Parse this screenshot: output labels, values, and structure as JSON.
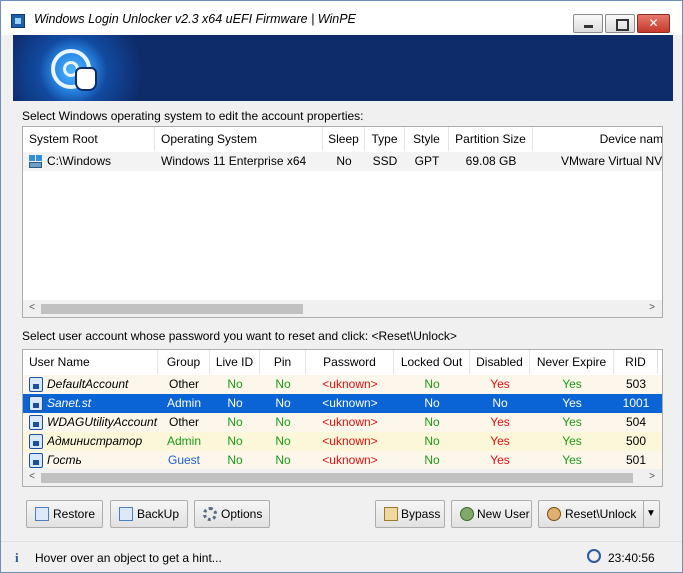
{
  "window": {
    "title": "Windows Login Unlocker v2.3 x64   uEFI Firmware | WinPE",
    "min_symbol": "",
    "max_symbol": "",
    "close_symbol": "✕"
  },
  "os_section": {
    "label": "Select Windows operating system to edit the account properties:",
    "columns": [
      "System Root",
      "Operating System",
      "Sleep",
      "Type",
      "Style",
      "Partition Size",
      "Device nam"
    ],
    "rows": [
      [
        "C:\\Windows",
        "Windows 11 Enterprise x64",
        "No",
        "SSD",
        "GPT",
        "69.08 GB",
        "VMware Virtual NV"
      ]
    ],
    "scroll_left": "<",
    "scroll_right": ">"
  },
  "user_section": {
    "label": "Select user account whose password you want to reset and click: <Reset\\Unlock>",
    "columns": [
      "User Name",
      "Group",
      "Live ID",
      "Pin",
      "Password",
      "Locked Out",
      "Disabled",
      "Never Expire",
      "RID"
    ],
    "rows": [
      [
        "DefaultAccount",
        "Other",
        "No",
        "No",
        "<uknown>",
        "No",
        "Yes",
        "Yes",
        "503"
      ],
      [
        "Sanet.st",
        "Admin",
        "No",
        "No",
        "<uknown>",
        "No",
        "No",
        "Yes",
        "1001"
      ],
      [
        "WDAGUtilityAccount",
        "Other",
        "No",
        "No",
        "<uknown>",
        "No",
        "Yes",
        "Yes",
        "504"
      ],
      [
        "Администратор",
        "Admin",
        "No",
        "No",
        "<uknown>",
        "No",
        "Yes",
        "Yes",
        "500"
      ],
      [
        "Гость",
        "Guest",
        "No",
        "No",
        "<uknown>",
        "No",
        "Yes",
        "Yes",
        "501"
      ]
    ],
    "selected_row": 1,
    "scroll_left": "<",
    "scroll_right": ">"
  },
  "buttons": {
    "restore": "Restore",
    "backup": "BackUp",
    "options": "Options",
    "bypass": "Bypass",
    "new_user": "New User",
    "reset_unlock": "Reset\\Unlock",
    "dropdown_arrow": "▼"
  },
  "status": {
    "info_icon": "i",
    "hint": "Hover over an object to get a hint...",
    "time": "23:40:56"
  },
  "colors": {
    "green": "#1a9a1a",
    "red": "#e01010",
    "blue_guest": "#1a5fd0",
    "selected_bg": "#0a64d6",
    "row_tint": "#fdf6ea",
    "row_yellow": "#fbf7d8"
  },
  "icons": {
    "app": "unlocker-app-icon",
    "drive": "windows-drive-icon",
    "user": "user-account-icon",
    "restore": "restore-icon",
    "backup": "backup-icon",
    "options": "gear-icon",
    "bypass": "bypass-icon",
    "new_user": "add-user-icon",
    "reset": "reset-unlock-icon",
    "clock": "clock-icon"
  }
}
